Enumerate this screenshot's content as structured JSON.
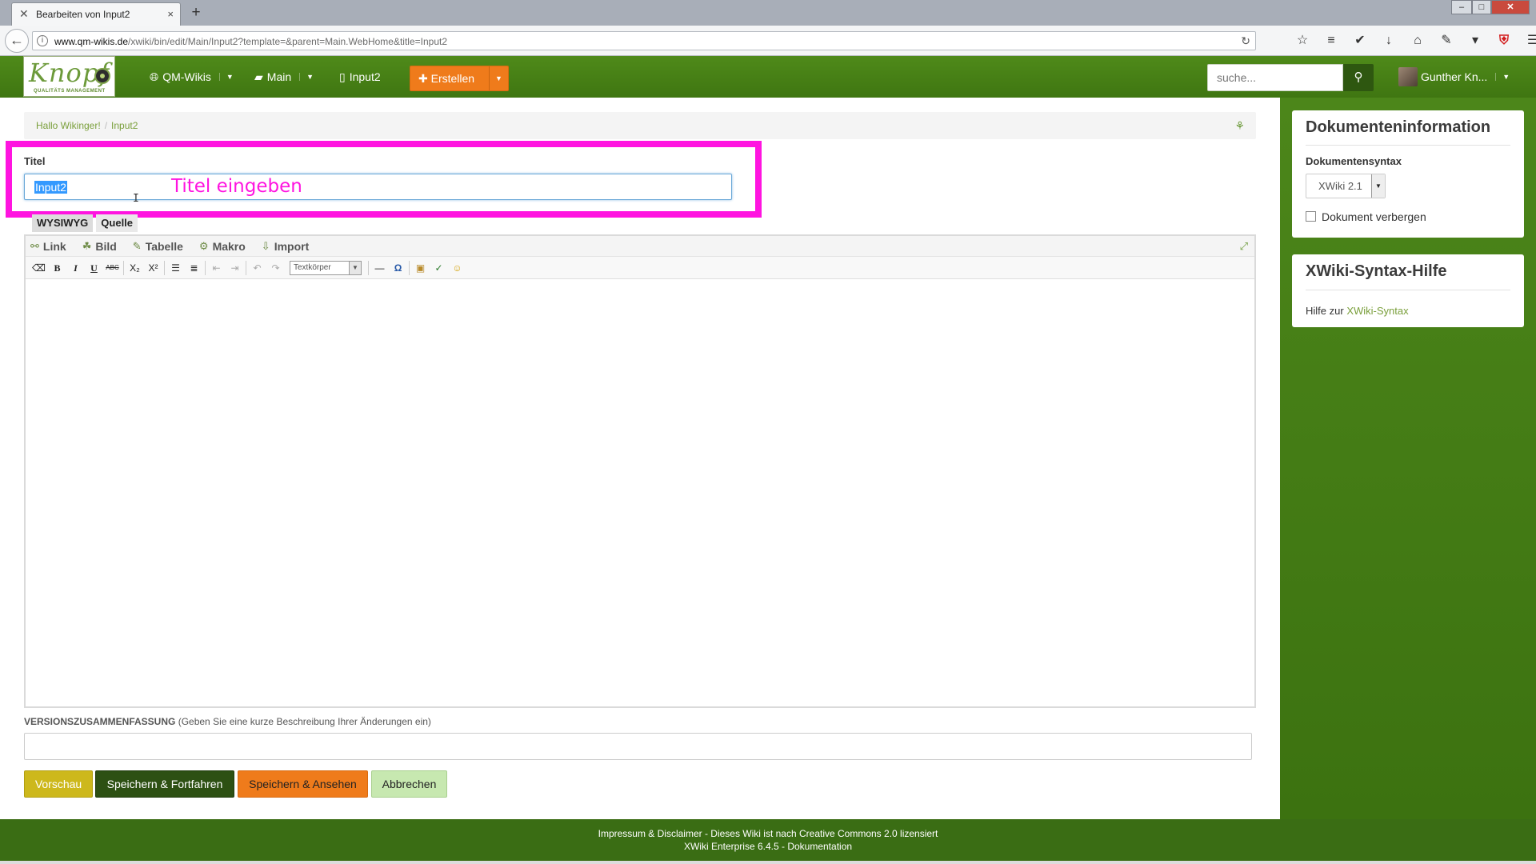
{
  "browser": {
    "tab_title": "Bearbeiten von Input2",
    "url_host": "www.qm-wikis.de",
    "url_path": "/xwiki/bin/edit/Main/Input2?template=&parent=Main.WebHome&title=Input2",
    "new_tab": "+",
    "icons": {
      "back": "←",
      "info": "i",
      "reload": "↻",
      "tab_close": "×",
      "star": "☆",
      "reader": "≡",
      "pocket": "✔",
      "download": "↓",
      "home": "⌂",
      "tools": "✎",
      "more": "▾",
      "shield": "⛨",
      "menu": "☰"
    }
  },
  "header": {
    "logo_word": "Knopf",
    "logo_sub": "QUALITÄTS MANAGEMENT",
    "nav": {
      "wiki": "QM-Wikis",
      "space": "Main",
      "page": "Input2"
    },
    "create_label": "Erstellen",
    "search_placeholder": "suche...",
    "user_name": "Gunther Kn..."
  },
  "breadcrumb": {
    "home": "Hallo Wikinger!",
    "current": "Input2",
    "sep": "/"
  },
  "form": {
    "title_label": "Titel",
    "title_value": "Input2",
    "annotation": "Titel eingeben",
    "tabs": [
      "WYSIWYG",
      "Quelle"
    ],
    "editor_menu": [
      {
        "label": "Link",
        "icon": "⚯"
      },
      {
        "label": "Bild",
        "icon": "☘"
      },
      {
        "label": "Tabelle",
        "icon": "✎"
      },
      {
        "label": "Makro",
        "icon": "⚙"
      },
      {
        "label": "Import",
        "icon": "⇩"
      }
    ],
    "style_select": "Textkörper",
    "summary_label": "VERSIONSZUSAMMENFASSUNG",
    "summary_hint": "(Geben Sie eine kurze Beschreibung Ihrer Änderungen ein)",
    "buttons": {
      "preview": "Vorschau",
      "save_continue": "Speichern & Fortfahren",
      "save_view": "Speichern & Ansehen",
      "cancel": "Abbrechen"
    }
  },
  "sidebar": {
    "docinfo_title": "Dokumenteninformation",
    "syntax_label": "Dokumentensyntax",
    "syntax_value": "XWiki 2.1",
    "hide_label": "Dokument verbergen",
    "help_title": "XWiki-Syntax-Hilfe",
    "help_prefix": "Hilfe zur",
    "help_link": "XWiki-Syntax"
  },
  "footer": {
    "line1": "Impressum & Disclaimer - Dieses Wiki ist nach Creative Commons 2.0 lizensiert",
    "line2": "XWiki Enterprise 6.4.5 - Dokumentation"
  },
  "colors": {
    "brand_green": "#3f7611",
    "accent_orange": "#ef7b1b",
    "highlight_magenta": "#ff14e0",
    "link_green": "#7a9f3b"
  }
}
